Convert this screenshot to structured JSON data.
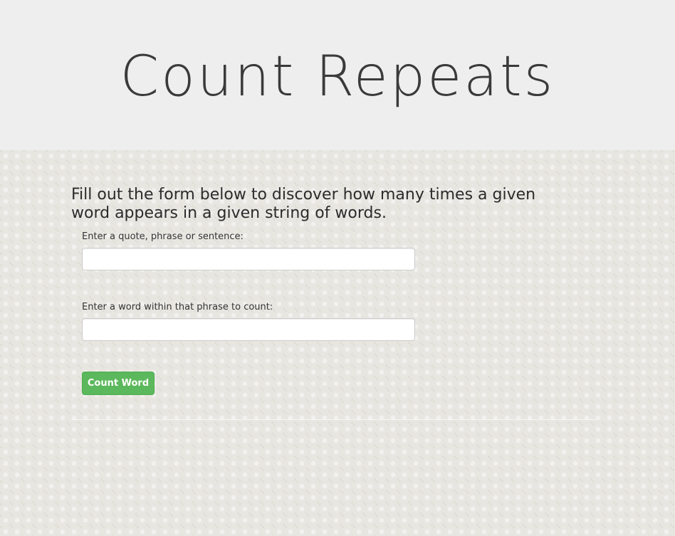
{
  "header": {
    "title": "Count Repeats"
  },
  "main": {
    "intro": "Fill out the form below to discover how many times a given word appears in a given string of words.",
    "phrase_field": {
      "label": "Enter a quote, phrase or sentence:",
      "value": "",
      "placeholder": ""
    },
    "word_field": {
      "label": "Enter a word within that phrase to count:",
      "value": "",
      "placeholder": ""
    },
    "submit_label": "Count Word"
  },
  "colors": {
    "header_bg": "#eeeeee",
    "content_bg": "#e8e6e1",
    "button_green": "#5cb85c",
    "title_text": "#3a3a3a"
  }
}
